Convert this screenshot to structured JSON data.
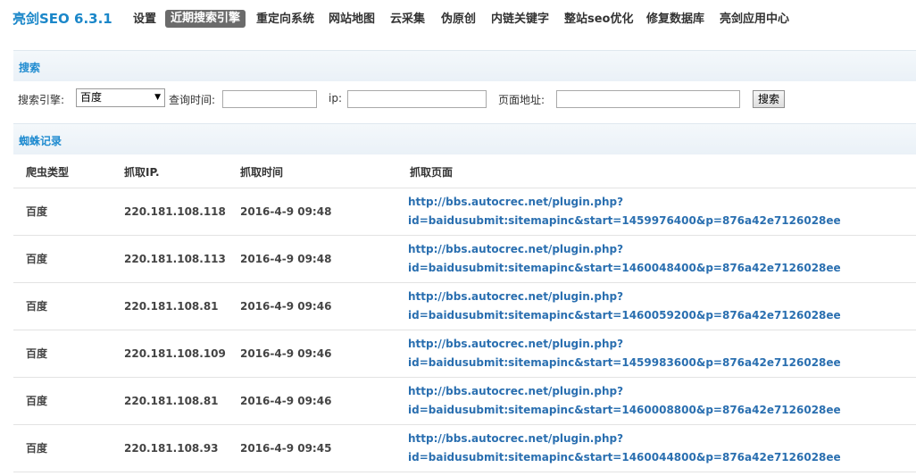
{
  "brand": "亮剑SEO 6.3.1",
  "nav": [
    {
      "label": "设置",
      "active": false
    },
    {
      "label": "近期搜索引擎",
      "active": true
    },
    {
      "label": "重定向系统",
      "active": false
    },
    {
      "label": "网站地图",
      "active": false
    },
    {
      "label": "云采集",
      "active": false
    },
    {
      "label": "伪原创",
      "active": false
    },
    {
      "label": "内链关键字",
      "active": false
    },
    {
      "label": "整站seo优化",
      "active": false
    },
    {
      "label": "修复数据库",
      "active": false
    },
    {
      "label": "亮剑应用中心",
      "active": false
    }
  ],
  "search_section": {
    "title": "搜索",
    "engine_label": "搜索引擎:",
    "engine_value": "百度",
    "time_label": "查询时间:",
    "time_value": "",
    "ip_label": "ip:",
    "ip_value": "",
    "page_label": "页面地址:",
    "page_value": "",
    "submit_label": "搜索"
  },
  "records_section": {
    "title": "蜘蛛记录",
    "columns": [
      "爬虫类型",
      "抓取IP.",
      "抓取时间",
      "抓取页面"
    ],
    "rows": [
      {
        "type": "百度",
        "ip": "220.181.108.118",
        "time": "2016-4-9 09:48",
        "url1": "http://bbs.autocrec.net/plugin.php?",
        "url2": "id=baidusubmit:sitemapinc&start=1459976400&p=876a42e7126028ee"
      },
      {
        "type": "百度",
        "ip": "220.181.108.113",
        "time": "2016-4-9 09:48",
        "url1": "http://bbs.autocrec.net/plugin.php?",
        "url2": "id=baidusubmit:sitemapinc&start=1460048400&p=876a42e7126028ee"
      },
      {
        "type": "百度",
        "ip": "220.181.108.81",
        "time": "2016-4-9 09:46",
        "url1": "http://bbs.autocrec.net/plugin.php?",
        "url2": "id=baidusubmit:sitemapinc&start=1460059200&p=876a42e7126028ee"
      },
      {
        "type": "百度",
        "ip": "220.181.108.109",
        "time": "2016-4-9 09:46",
        "url1": "http://bbs.autocrec.net/plugin.php?",
        "url2": "id=baidusubmit:sitemapinc&start=1459983600&p=876a42e7126028ee"
      },
      {
        "type": "百度",
        "ip": "220.181.108.81",
        "time": "2016-4-9 09:46",
        "url1": "http://bbs.autocrec.net/plugin.php?",
        "url2": "id=baidusubmit:sitemapinc&start=1460008800&p=876a42e7126028ee"
      },
      {
        "type": "百度",
        "ip": "220.181.108.93",
        "time": "2016-4-9 09:45",
        "url1": "http://bbs.autocrec.net/plugin.php?",
        "url2": "id=baidusubmit:sitemapinc&start=1460044800&p=876a42e7126028ee"
      }
    ]
  },
  "colors": {
    "brand": "#1b87c9",
    "section_title": "#1f8bd0",
    "link": "#2a6fb0",
    "active_tab": "#6b6b6b"
  }
}
